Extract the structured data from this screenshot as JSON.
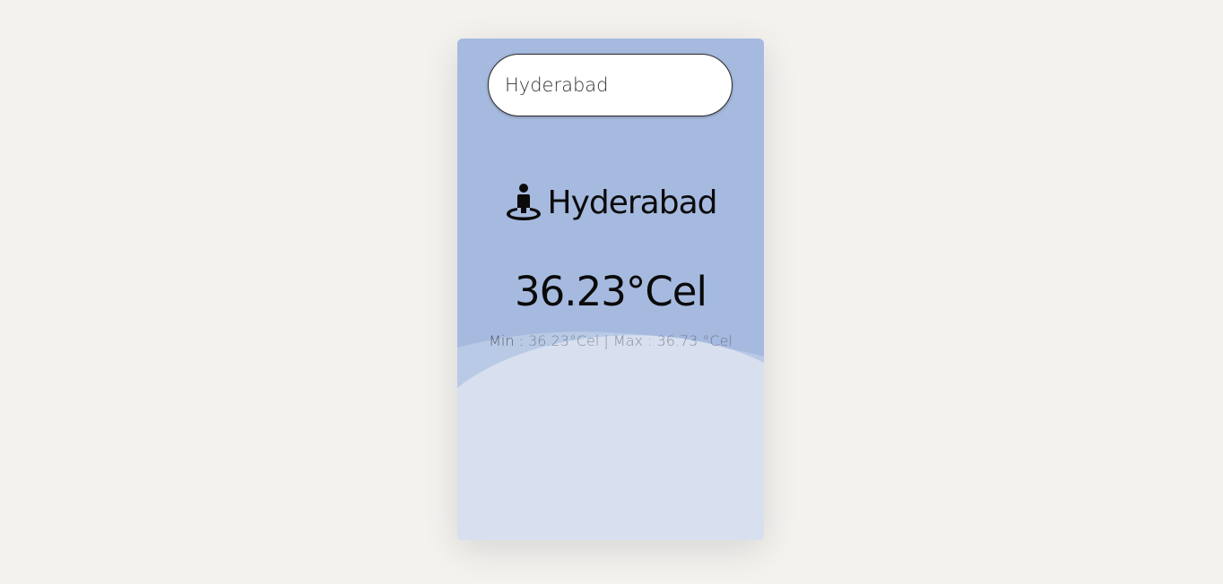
{
  "search": {
    "value": "Hyderabad"
  },
  "weather": {
    "city": "Hyderabad",
    "temperature": "36.23°Cel",
    "min_label": "Min : ",
    "min_value": "36.23°Cel",
    "separator": " | ",
    "max_label": "Max : ",
    "max_value": "36.73 °Cel"
  },
  "icons": {
    "location": "person-pin-icon"
  },
  "colors": {
    "page_background": "#f3f2ef",
    "card_top": "#a6badf",
    "card_bottom": "#d8e0ef",
    "text": "#0a0a0a"
  }
}
